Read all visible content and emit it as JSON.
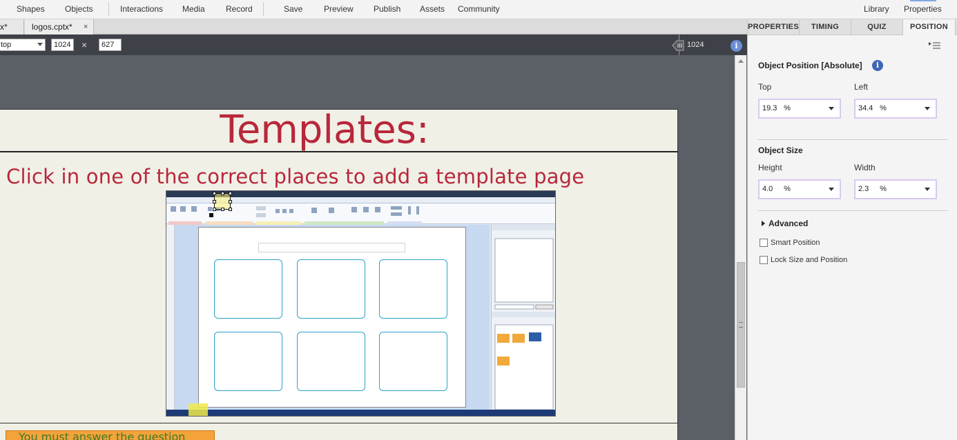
{
  "toolbar": {
    "items": [
      "Shapes",
      "Objects",
      "Interactions",
      "Media",
      "Record",
      "Save",
      "Preview",
      "Publish",
      "Assets",
      "Community",
      "Library",
      "Properties"
    ]
  },
  "tabs": {
    "first_label": "x*",
    "second_label": "logos.cptx*",
    "close": "×"
  },
  "stagebar": {
    "device_value": "top",
    "width_value": "1024",
    "height_value": "627",
    "times": "×",
    "ruler_value": "1024",
    "info": "i"
  },
  "slide": {
    "title": "Templates:",
    "subtitle": "Click in one of the correct places to add a template page",
    "caption": "You must answer the question"
  },
  "panel": {
    "tabs": [
      "PROPERTIES",
      "TIMING",
      "QUIZ",
      "POSITION"
    ],
    "active_tab": "POSITION",
    "position_title": "Object Position [Absolute]",
    "info": "i",
    "top_label": "Top",
    "top_value": "19.3",
    "left_label": "Left",
    "left_value": "34.4",
    "size_title": "Object Size",
    "height_label": "Height",
    "height_value": "4.0",
    "width_label": "Width",
    "width_value": "2.3",
    "unit": "%",
    "advanced_label": "Advanced",
    "smart_position_label": "Smart Position",
    "lock_label": "Lock Size and Position"
  },
  "colors": {
    "title_red": "#b8273a",
    "stage_bg": "#5b5f66",
    "field_border": "#d7c9f0",
    "caption_orange": "#f3a33a"
  }
}
